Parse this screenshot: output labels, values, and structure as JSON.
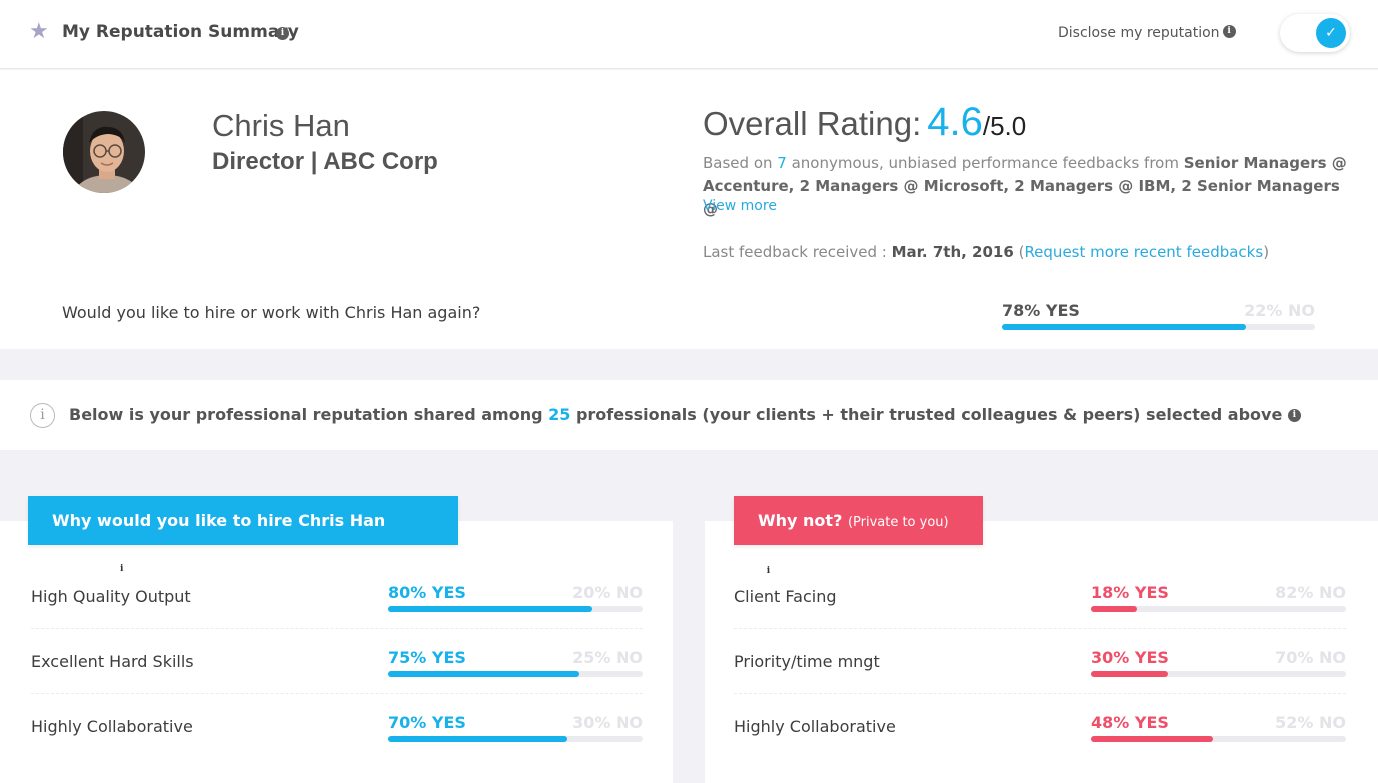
{
  "header": {
    "title": "My Reputation Summary",
    "disclose_label": "Disclose my reputation",
    "toggle_on": true
  },
  "profile": {
    "name": "Chris Han",
    "role": "Director | ABC Corp",
    "rating_label": "Overall Rating:",
    "rating_value": "4.6",
    "rating_max": "/5.0",
    "based_prefix": "Based on ",
    "feedback_count": "7",
    "based_mid": " anonymous, unbiased performance feedbacks from ",
    "based_sources": "Senior Managers @ Accenture, 2 Managers @ Microsoft, 2 Managers @ IBM, 2 Senior Managers @",
    "view_more": "View more",
    "last_feedback_label": "Last feedback received : ",
    "last_feedback_date": "Mar. 7th, 2016",
    "request_link": "Request more recent feedbacks",
    "rehire_question": "Would you like to hire or work with Chris Han again?",
    "rehire_yes": "78% YES",
    "rehire_no": "22% NO",
    "rehire_fraction": 0.78
  },
  "notice": {
    "prefix": "Below is your professional reputation shared among ",
    "count": "25",
    "suffix": " professionals (your clients + their trusted colleagues & peers) selected above"
  },
  "why": {
    "title": "Why would you like to hire Chris Han again?",
    "rows": [
      {
        "label": "High Quality Output",
        "yes": "80% YES",
        "no": "20% NO",
        "fraction": 0.8
      },
      {
        "label": "Excellent Hard Skills",
        "yes": "75% YES",
        "no": "25% NO",
        "fraction": 0.75
      },
      {
        "label": "Highly Collaborative",
        "yes": "70% YES",
        "no": "30% NO",
        "fraction": 0.7
      }
    ]
  },
  "why_not": {
    "title": "Why not?",
    "title_note": "(Private to you)",
    "rows": [
      {
        "label": "Client Facing",
        "yes": "18% YES",
        "no": "82% NO",
        "fraction": 0.18
      },
      {
        "label": "Priority/time mngt",
        "yes": "30% YES",
        "no": "70% NO",
        "fraction": 0.3
      },
      {
        "label": "Highly Collaborative",
        "yes": "48% YES",
        "no": "52% NO",
        "fraction": 0.48
      }
    ]
  },
  "colors": {
    "accent_blue": "#17b1ec",
    "accent_pink": "#ef4f69",
    "no_text": "#e3e3e8",
    "rehire_bar": "#17b1ec"
  }
}
